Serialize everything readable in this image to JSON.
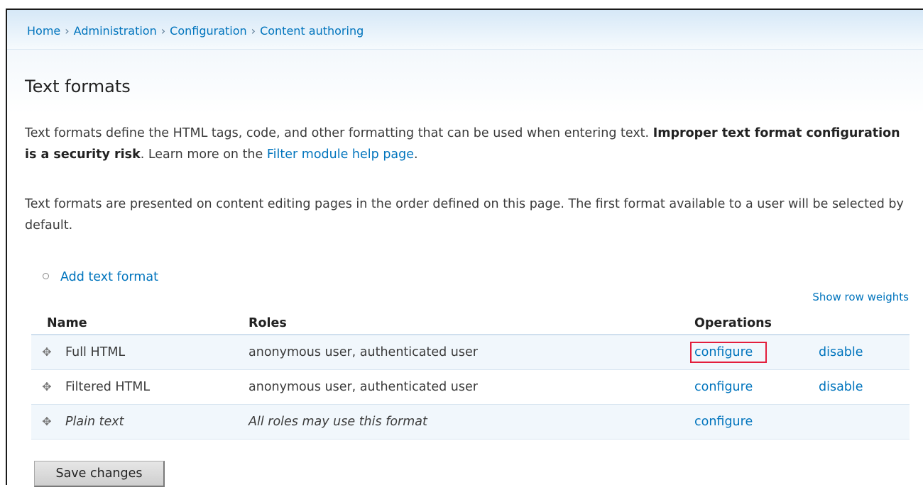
{
  "breadcrumb": {
    "items": [
      "Home",
      "Administration",
      "Configuration",
      "Content authoring"
    ],
    "separator": "›"
  },
  "page": {
    "title": "Text formats",
    "intro_part1": "Text formats define the HTML tags, code, and other formatting that can be used when entering text.",
    "intro_bold": "Improper text format configuration is a security risk",
    "intro_part2": ". Learn more on the",
    "intro_link": "Filter module help page",
    "intro_end": ".",
    "order_note": "Text formats are presented on content editing pages in the order defined on this page. The first format available to a user will be selected by default."
  },
  "actions": {
    "add_text_format": "Add text format",
    "show_row_weights": "Show row weights"
  },
  "table": {
    "headers": {
      "name": "Name",
      "roles": "Roles",
      "operations": "Operations"
    },
    "rows": [
      {
        "name": "Full HTML",
        "roles": "anonymous user, authenticated user",
        "configure": "configure",
        "disable": "disable",
        "italic": false,
        "highlighted": true
      },
      {
        "name": "Filtered HTML",
        "roles": "anonymous user, authenticated user",
        "configure": "configure",
        "disable": "disable",
        "italic": false,
        "highlighted": false
      },
      {
        "name": "Plain text",
        "roles": "All roles may use this format",
        "configure": "configure",
        "disable": "",
        "italic": true,
        "highlighted": false
      }
    ]
  },
  "buttons": {
    "save": "Save changes"
  },
  "colors": {
    "link": "#0074bd",
    "highlight_border": "#e31e3c"
  },
  "icons": {
    "drag_handle": "drag-handle-icon"
  }
}
